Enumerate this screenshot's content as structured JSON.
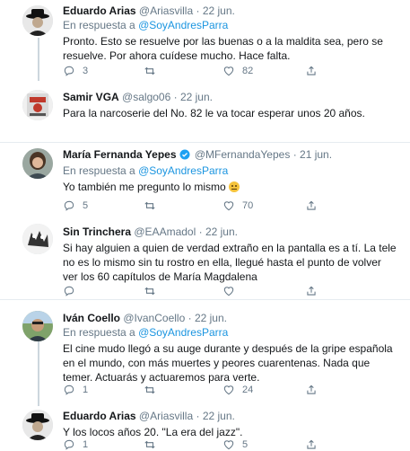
{
  "tweets": [
    {
      "name": "Eduardo Arias",
      "handle": "@Ariasvilla",
      "date": "22 jun.",
      "reply_prefix": "En respuesta a",
      "reply_to": "@SoyAndresParra",
      "text": "Pronto. Esto se resuelve por las buenas o a la maldita sea, pero se resuelve. Por ahora cuídese mucho. Hace falta.",
      "replies": "3",
      "retweets": "",
      "likes": "82"
    },
    {
      "name": "Samir VGA",
      "handle": "@salgo06",
      "date": "22 jun.",
      "text": "Para la narcoserie del No. 82 le va tocar esperar unos 20 años.",
      "replies": "",
      "retweets": "",
      "likes": ""
    },
    {
      "name": "María Fernanda Yepes",
      "handle": "@MFernandaYepes",
      "date": "21 jun.",
      "verified": true,
      "reply_prefix": "En respuesta a",
      "reply_to": "@SoyAndresParra",
      "text": "Yo también me pregunto lo mismo",
      "emoji": "thinking-face-emoji",
      "replies": "5",
      "retweets": "",
      "likes": "70"
    },
    {
      "name": "Sin Trinchera",
      "handle": "@EAAmadol",
      "date": "22 jun.",
      "text": "Si hay alguien a quien de verdad extraño en la pantalla es a tí. La tele no es lo mismo sin tu rostro en ella, llegué hasta el punto de volver ver los 60 capítulos de María Magdalena",
      "replies": "",
      "retweets": "",
      "likes": ""
    },
    {
      "name": "Iván Coello",
      "handle": "@IvanCoello",
      "date": "22 jun.",
      "reply_prefix": "En respuesta a",
      "reply_to": "@SoyAndresParra",
      "text": "El cine mudo llegó a su auge durante y después de la gripe española en el mundo, con más muertes y peores cuarentenas. Nada que temer. Actuarás y actuaremos para verte.",
      "replies": "1",
      "retweets": "",
      "likes": "24"
    },
    {
      "name": "Eduardo Arias",
      "handle": "@Ariasvilla",
      "date": "22 jun.",
      "text": "Y los locos años 20. \"La era del jazz\".",
      "replies": "1",
      "retweets": "",
      "likes": "5"
    }
  ],
  "colors": {
    "link": "#1b95e0",
    "secondary_text": "#657786",
    "divider": "#e6ecf0",
    "thread_line": "#ccd6dd",
    "verified": "#1da1f2"
  },
  "icons": {
    "reply": "reply-icon",
    "retweet": "retweet-icon",
    "like": "heart-icon",
    "share": "share-icon",
    "verified": "verified-badge-icon"
  }
}
